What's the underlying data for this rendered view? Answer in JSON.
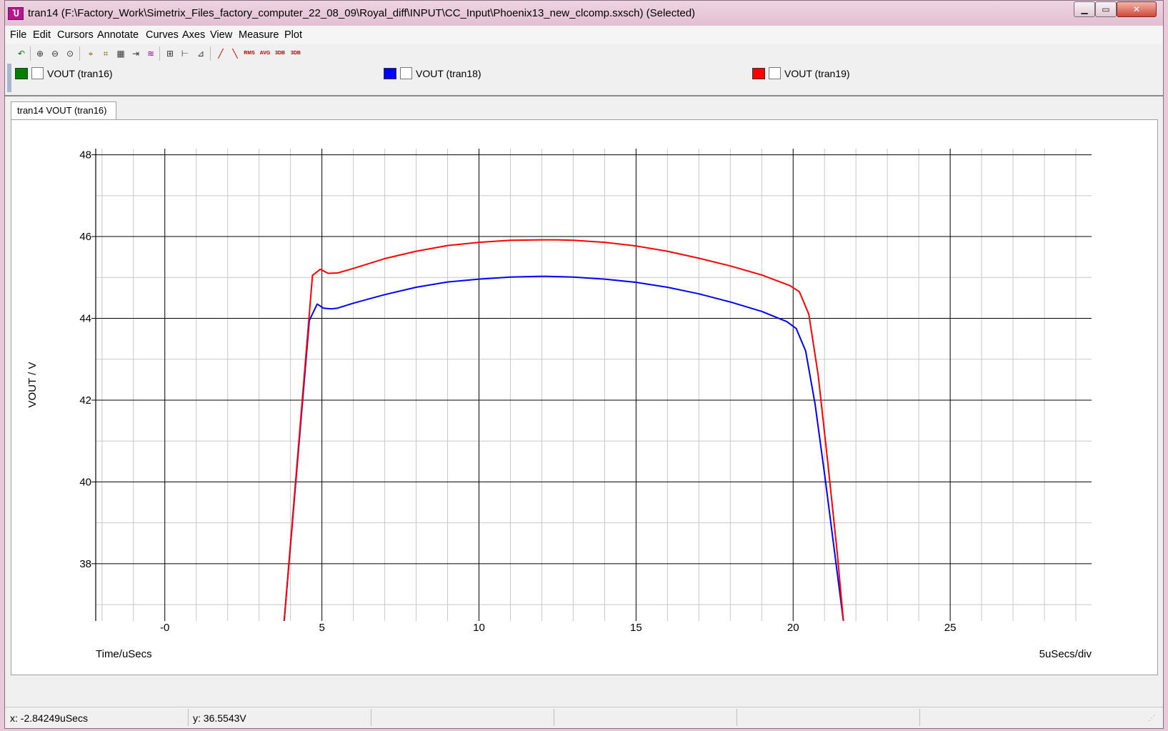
{
  "window": {
    "title": "tran14 (F:\\Factory_Work\\Simetrix_Files_factory_computer_22_08_09\\Royal_diff\\INPUT\\CC_Input\\Phoenix13_new_clcomp.sxsch) (Selected)",
    "app_icon": "waveform-icon"
  },
  "menu": [
    "File",
    "Edit",
    "Cursors",
    "Annotate",
    "Curves",
    "Axes",
    "View",
    "Measure",
    "Plot"
  ],
  "toolbar": {
    "icons": [
      "undo-icon",
      "zoom-in-icon",
      "zoom-out-icon",
      "zoom-full-icon",
      "cursor-icon",
      "cursor-text-icon",
      "abs-icon",
      "add-curve-icon",
      "curve-select-icon",
      "grid-icon",
      "axes-icon",
      "new-axes-icon",
      "rise-icon",
      "fall-icon",
      "rms-icon",
      "avg-icon",
      "3db-lower-icon",
      "3db-upper-icon"
    ],
    "labels": {
      "rms": "RMS",
      "avg": "AVG",
      "db1": "3DB",
      "db2": "3DB"
    }
  },
  "legend": [
    {
      "label": "VOUT (tran16)",
      "color": "#008000"
    },
    {
      "label": "VOUT (tran18)",
      "color": "#0000ff"
    },
    {
      "label": "VOUT (tran19)",
      "color": "#ff0000"
    }
  ],
  "tab": {
    "label": "tran14 VOUT (tran16)"
  },
  "chart_data": {
    "type": "line",
    "xlabel": "Time/uSecs",
    "ylabel": "VOUT / V",
    "x_scale_note": "5uSecs/div",
    "xlim": [
      -2.2,
      29.5
    ],
    "ylim": [
      36.6,
      48.15
    ],
    "x_ticks": [
      0,
      5,
      10,
      15,
      20,
      25
    ],
    "x_tick_labels": [
      "-0",
      "5",
      "10",
      "15",
      "20",
      "25"
    ],
    "y_ticks": [
      38,
      40,
      42,
      44,
      46,
      48
    ],
    "y_tick_labels": [
      "38",
      "40",
      "42",
      "44",
      "46",
      "48"
    ],
    "grid": true,
    "series": [
      {
        "name": "VOUT (tran18)",
        "color": "#0000ff",
        "x": [
          3.8,
          4.6,
          4.85,
          5.05,
          5.3,
          5.5,
          6,
          7,
          8,
          9,
          10,
          11,
          12,
          12.5,
          13,
          14,
          15,
          16,
          17,
          18,
          19,
          19.8,
          20.1,
          20.4,
          20.7,
          21,
          21.3,
          21.6
        ],
        "y": [
          36.6,
          43.95,
          44.35,
          44.25,
          44.23,
          44.25,
          44.37,
          44.58,
          44.76,
          44.89,
          44.96,
          45.01,
          45.03,
          45.02,
          45.01,
          44.96,
          44.88,
          44.76,
          44.6,
          44.4,
          44.17,
          43.92,
          43.75,
          43.2,
          41.9,
          40.2,
          38.4,
          36.6
        ]
      },
      {
        "name": "VOUT (tran19)",
        "color": "#ff0000",
        "x": [
          3.8,
          4.7,
          4.95,
          5.2,
          5.5,
          6,
          7,
          8,
          9,
          10,
          11,
          12,
          12.5,
          13,
          14,
          15,
          16,
          17,
          18,
          19,
          19.9,
          20.2,
          20.5,
          20.8,
          21.1,
          21.4,
          21.6
        ],
        "y": [
          36.6,
          45.05,
          45.2,
          45.1,
          45.11,
          45.22,
          45.46,
          45.64,
          45.78,
          45.86,
          45.91,
          45.92,
          45.92,
          45.91,
          45.86,
          45.77,
          45.64,
          45.47,
          45.28,
          45.06,
          44.8,
          44.65,
          44.1,
          42.6,
          40.5,
          38.3,
          36.6
        ]
      }
    ]
  },
  "status": {
    "x": "x: -2.84249uSecs",
    "y": "y: 36.5543V"
  }
}
